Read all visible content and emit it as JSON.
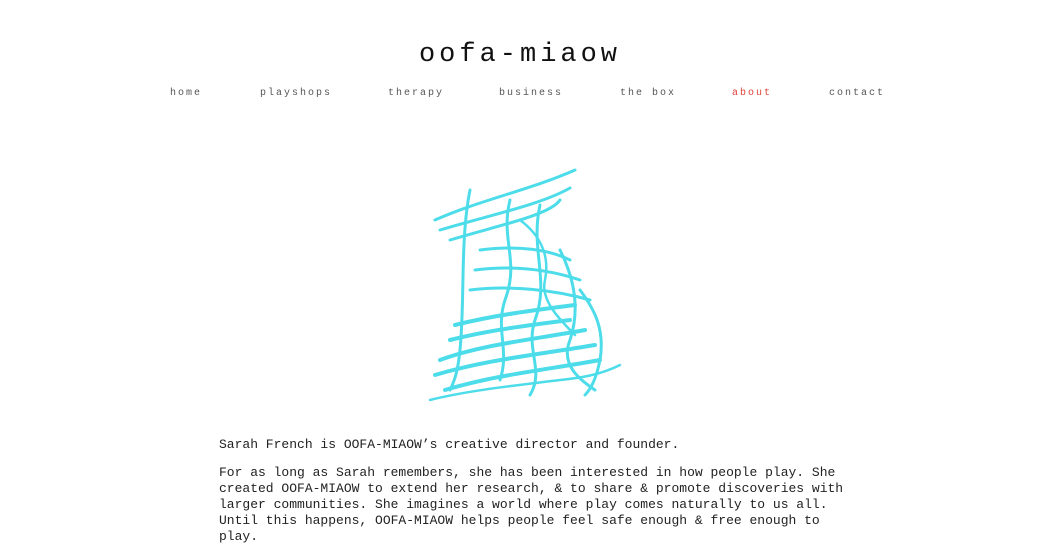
{
  "header": {
    "title": "oofa-miaow"
  },
  "nav": {
    "items": [
      {
        "label": "home"
      },
      {
        "label": "playshops"
      },
      {
        "label": "therapy"
      },
      {
        "label": "business"
      },
      {
        "label": "the box"
      },
      {
        "label": "about"
      },
      {
        "label": "contact"
      }
    ],
    "active": "about"
  },
  "colors": {
    "accent": "#e0443a",
    "scribble": "#2fd7e6"
  },
  "illustration": {
    "icon": "scribble-drawing-icon"
  },
  "content": {
    "intro": "Sarah French is OOFA-MIAOW’s creative director and founder.",
    "body": "For as long as Sarah remembers, she has been interested in how people play. She created OOFA-MIAOW to extend her research, & to share & promote discoveries with larger communities. She imagines a world where play comes naturally to us all. Until this happens, OOFA-MIAOW helps people feel safe enough & free enough to play."
  }
}
